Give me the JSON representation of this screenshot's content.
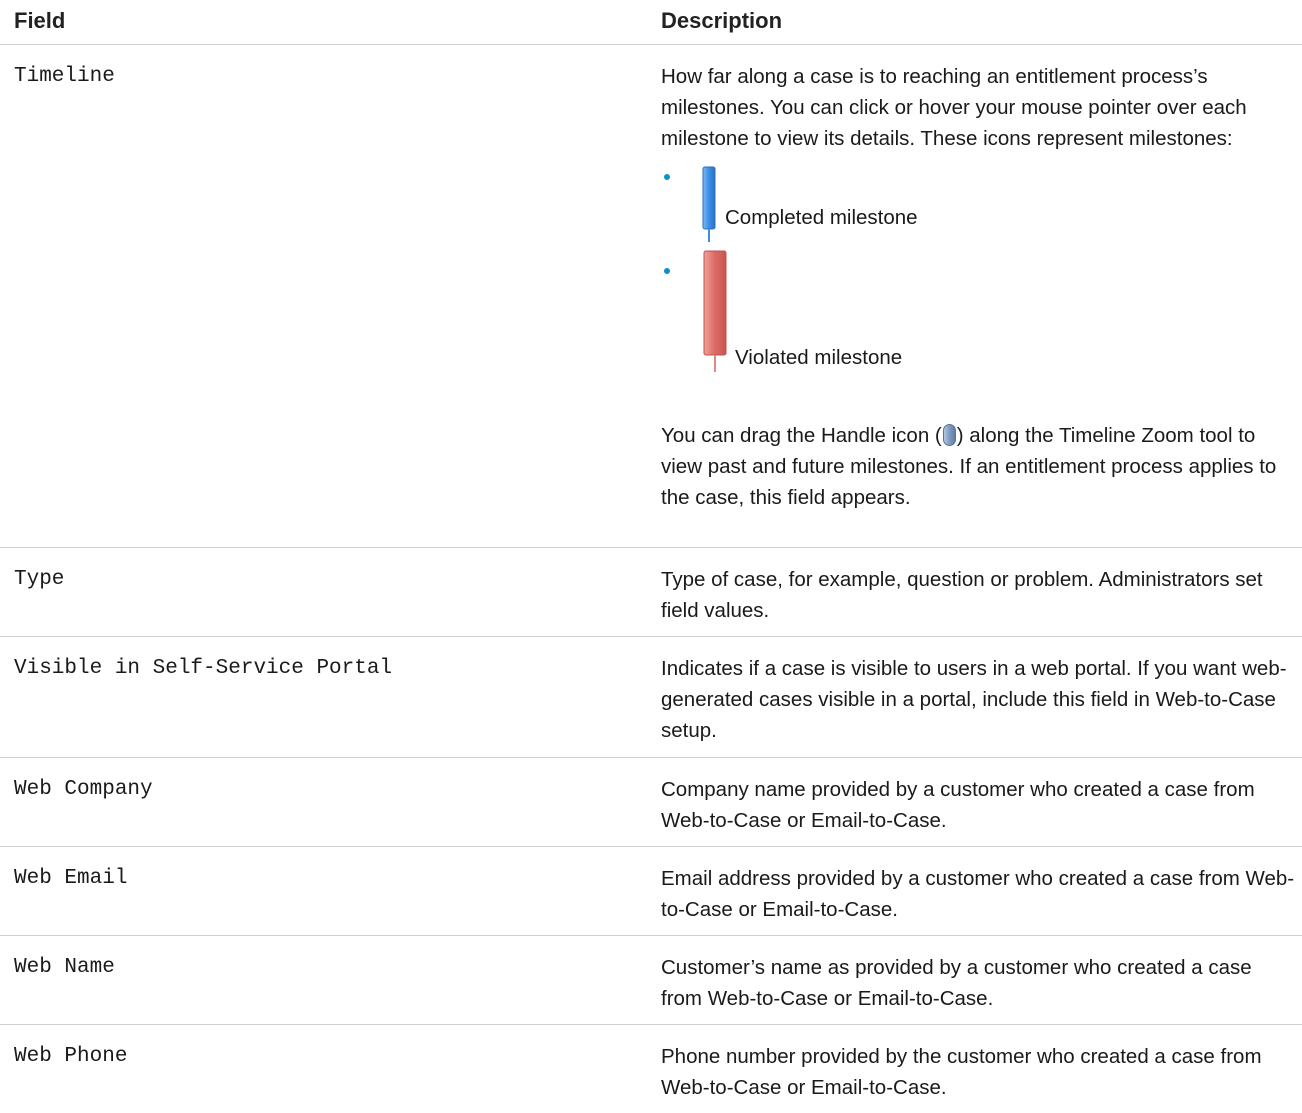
{
  "table": {
    "headers": {
      "field": "Field",
      "description": "Description"
    },
    "timeline": {
      "field": "Timeline",
      "intro": "How far along a case is to reaching an entitlement process’s milestones. You can click or hover your mouse pointer over each milestone to view its details. These icons represent milestones:",
      "milestones": [
        {
          "label": "Completed milestone",
          "icon": "completed-milestone-icon",
          "color": "#3b8ee6"
        },
        {
          "label": "Violated milestone",
          "icon": "violated-milestone-icon",
          "color": "#dc6a66"
        }
      ],
      "drag_before": "You can drag the Handle icon (",
      "drag_after": ") along the Timeline Zoom tool to view past and future milestones. If an entitlement process applies to the case, this field appears."
    },
    "rows": [
      {
        "field": "Type",
        "description": "Type of case, for example, question or problem. Administrators set field values."
      },
      {
        "field": "Visible in Self-Service Portal",
        "description": "Indicates if a case is visible to users in a web portal. If you want web-generated cases visible in a portal, include this field in Web-to-Case setup."
      },
      {
        "field": "Web Company",
        "description": "Company name provided by a customer who created a case from Web-to-Case or Email-to-Case."
      },
      {
        "field": "Web Email",
        "description": "Email address provided by a customer who created a case from Web-to-Case or Email-to-Case."
      },
      {
        "field": "Web Name",
        "description": "Customer’s name as provided by a customer who created a case from Web-to-Case or Email-to-Case."
      },
      {
        "field": "Web Phone",
        "description": "Phone number provided by the customer who created a case from Web-to-Case or Email-to-Case."
      }
    ]
  },
  "colors": {
    "bullet": "#0a8fd1",
    "divider": "#d0d0d0",
    "handle": "#7f9bc0"
  }
}
